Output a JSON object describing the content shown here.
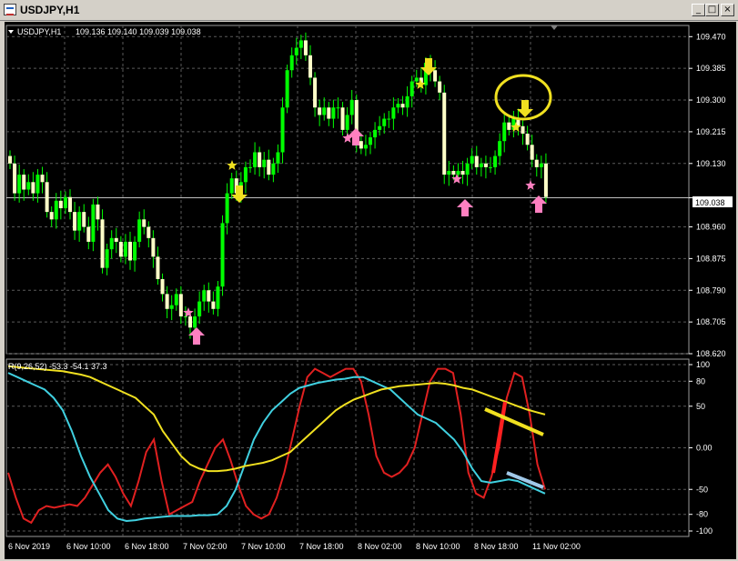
{
  "window": {
    "title": "USDJPY,H1"
  },
  "price_header": {
    "symbol_tf": "USDJPY,H1",
    "ohlc": "109.136 109.140 109.039 109.038"
  },
  "indicator_header": {
    "text": "R(9,26,52) -53.3 -54.1 37.3"
  },
  "current_price_label": "109.038",
  "price_axis_labels": [
    "109.470",
    "109.385",
    "109.300",
    "109.215",
    "109.130",
    "109.038",
    "108.960",
    "108.875",
    "108.790",
    "108.705",
    "108.620"
  ],
  "indicator_axis_labels": [
    "100",
    "80",
    "50",
    "0.00",
    "-50",
    "-80",
    "-100"
  ],
  "time_axis_labels": [
    "6 Nov 2019",
    "6 Nov 10:00",
    "6 Nov 18:00",
    "7 Nov 02:00",
    "7 Nov 10:00",
    "7 Nov 18:00",
    "8 Nov 02:00",
    "8 Nov 10:00",
    "8 Nov 18:00",
    "11 Nov 02:00"
  ],
  "colors": {
    "background": "#000000",
    "bull_candle": "#00ff00",
    "bear_candle": "#ffffc8",
    "grid": "#5a5a5a",
    "red_line": "#e02020",
    "cyan_line": "#40d0e0",
    "yellow_line": "#f0e020",
    "up_arrow": "#ff80c0",
    "down_arrow": "#f0e020"
  },
  "chart_data": [
    {
      "type": "candlestick",
      "title": "USDJPY,H1",
      "ylim": [
        108.62,
        109.5
      ],
      "close": [
        109.13,
        109.05,
        109.1,
        109.06,
        109.08,
        109.05,
        109.1,
        109.08,
        109.0,
        108.98,
        109.03,
        109.01,
        109.04,
        109.0,
        108.95,
        109.0,
        108.96,
        108.92,
        109.02,
        108.98,
        108.85,
        108.9,
        108.93,
        108.92,
        108.88,
        108.92,
        108.87,
        108.92,
        108.98,
        108.96,
        108.93,
        108.88,
        108.82,
        108.78,
        108.74,
        108.75,
        108.78,
        108.72,
        108.72,
        108.69,
        108.72,
        108.76,
        108.79,
        108.76,
        108.74,
        108.8,
        108.97,
        109.05,
        109.09,
        109.05,
        109.08,
        109.12,
        109.12,
        109.16,
        109.12,
        109.14,
        109.1,
        109.13,
        109.16,
        109.28,
        109.38,
        109.42,
        109.44,
        109.46,
        109.42,
        109.36,
        109.28,
        109.26,
        109.28,
        109.25,
        109.28,
        109.28,
        109.22,
        109.26,
        109.3,
        109.19,
        109.17,
        109.18,
        109.2,
        109.22,
        109.23,
        109.25,
        109.25,
        109.28,
        109.29,
        109.28,
        109.31,
        109.35,
        109.36,
        109.34,
        109.4,
        109.38,
        109.35,
        109.32,
        109.1,
        109.11,
        109.1,
        109.11,
        109.1,
        109.13,
        109.15,
        109.12,
        109.13,
        109.12,
        109.12,
        109.15,
        109.19,
        109.24,
        109.22,
        109.25,
        109.23,
        109.21,
        109.18,
        109.14,
        109.12,
        109.13,
        109.04
      ]
    },
    {
      "type": "line",
      "title": "R(9,26,52) -53.3 -54.1 37.3",
      "ylim": [
        -100,
        100
      ],
      "series": [
        {
          "values": [
            -30,
            -60,
            -85,
            -90,
            -75,
            -70,
            -72,
            -70,
            -68,
            -70,
            -60,
            -45,
            -30,
            -20,
            -35,
            -55,
            -70,
            -40,
            -5,
            10,
            -40,
            -80,
            -75,
            -70,
            -65,
            -40,
            -20,
            0,
            10,
            -15,
            -45,
            -70,
            -80,
            -85,
            -80,
            -60,
            -30,
            10,
            50,
            85,
            95,
            90,
            85,
            90,
            95,
            95,
            80,
            40,
            -10,
            -30,
            -35,
            -30,
            -20,
            0,
            40,
            80,
            95,
            95,
            90,
            40,
            -30,
            -55,
            -60,
            -35,
            0,
            60,
            90,
            85,
            40,
            -20,
            -50
          ]
        },
        {
          "values": [
            90,
            85,
            80,
            75,
            70,
            60,
            45,
            20,
            -10,
            -35,
            -55,
            -75,
            -85,
            -88,
            -87,
            -85,
            -84,
            -83,
            -82,
            -82,
            -82,
            -81,
            -81,
            -80,
            -70,
            -50,
            -20,
            10,
            30,
            45,
            55,
            65,
            72,
            75,
            78,
            80,
            82,
            83,
            85,
            85,
            80,
            75,
            70,
            60,
            50,
            40,
            35,
            30,
            20,
            10,
            -5,
            -25,
            -40,
            -42,
            -40,
            -38,
            -40,
            -45,
            -50,
            -55
          ]
        },
        {
          "values": [
            98,
            97,
            96,
            95,
            94,
            93,
            92,
            90,
            88,
            85,
            80,
            75,
            70,
            65,
            60,
            50,
            40,
            20,
            5,
            -10,
            -20,
            -25,
            -28,
            -28,
            -27,
            -25,
            -22,
            -20,
            -18,
            -15,
            -10,
            -5,
            5,
            15,
            25,
            35,
            45,
            52,
            58,
            62,
            66,
            70,
            72,
            74,
            75,
            76,
            77,
            78,
            77,
            75,
            72,
            70,
            66,
            62,
            58,
            54,
            50,
            46,
            43,
            40
          ]
        }
      ]
    }
  ]
}
